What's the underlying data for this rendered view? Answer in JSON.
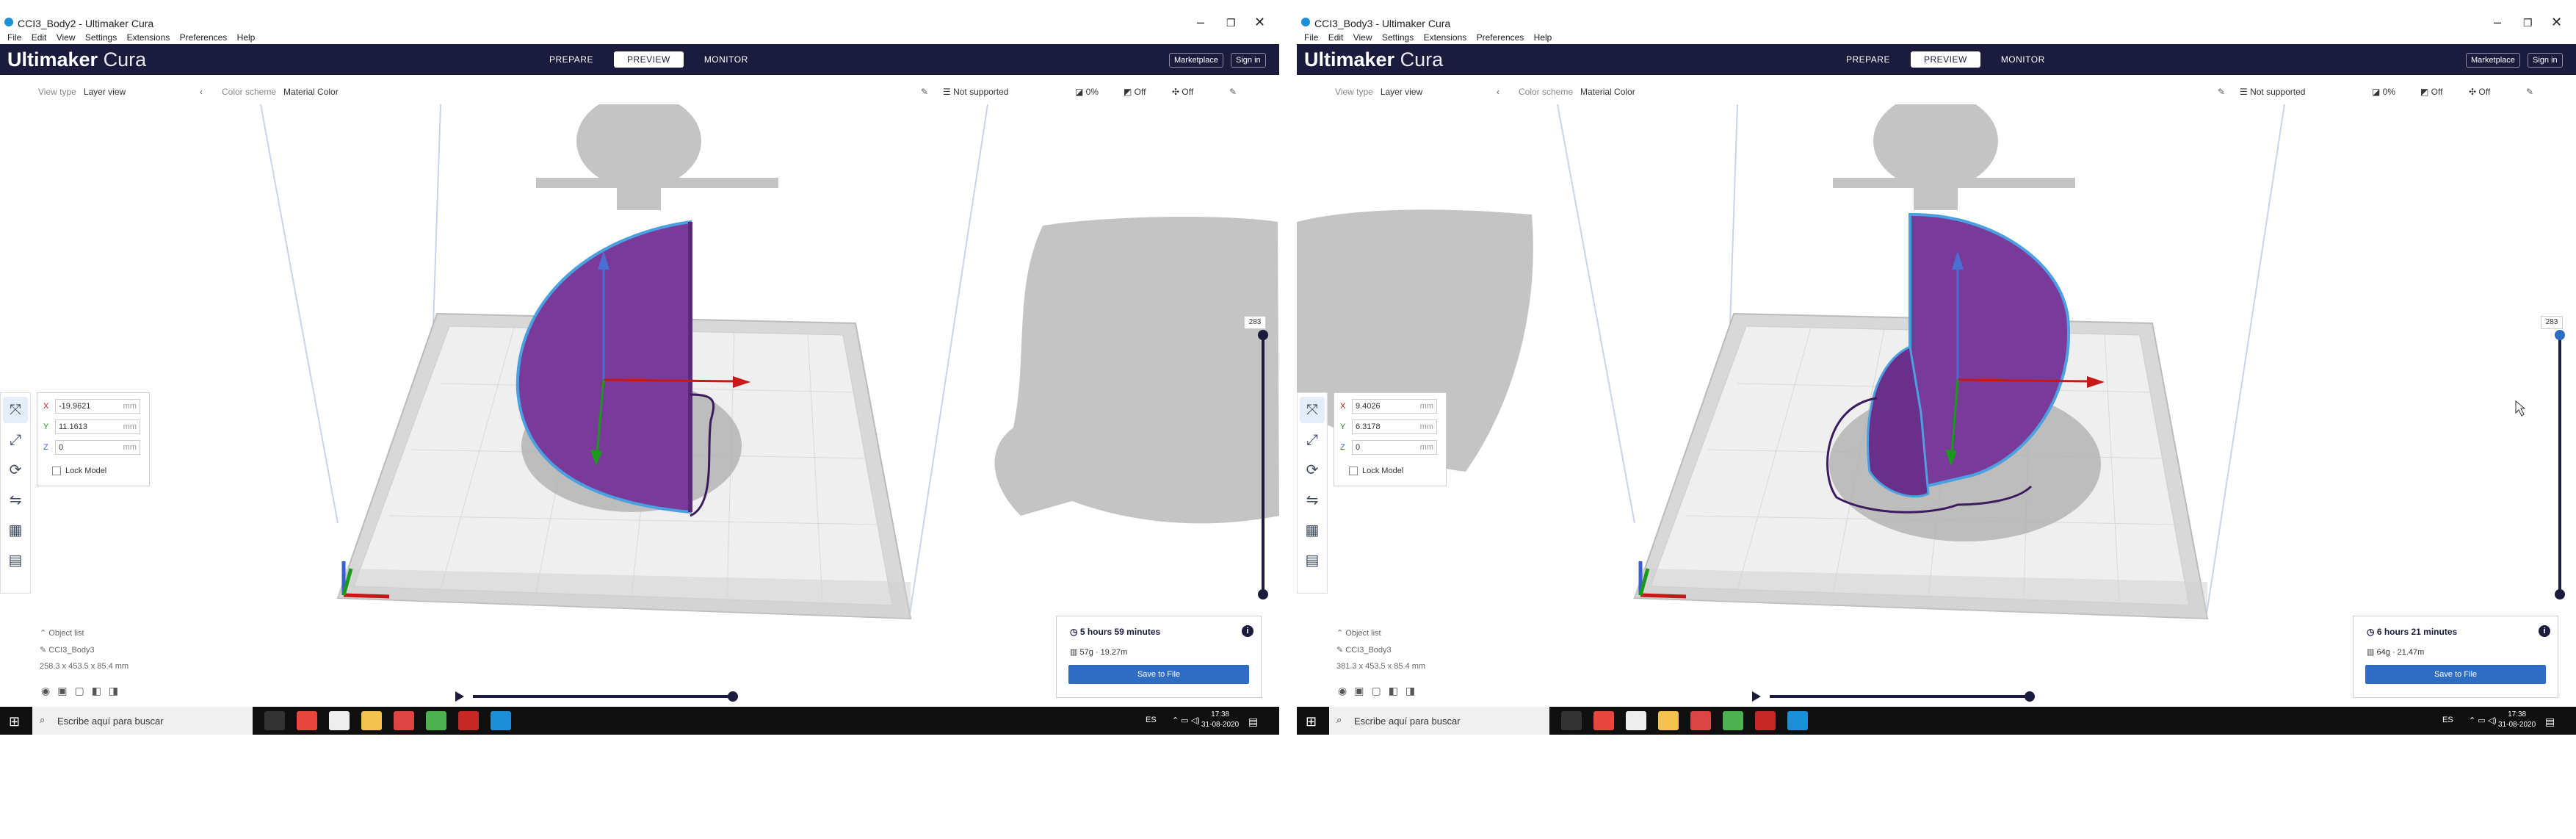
{
  "screens": [
    {
      "window_title": "CCI3_Body2 - Ultimaker Cura",
      "menu": [
        "File",
        "Edit",
        "View",
        "Settings",
        "Extensions",
        "Preferences",
        "Help"
      ],
      "logo": {
        "brand": "Ultimaker",
        "product": "Cura"
      },
      "stages": [
        "PREPARE",
        "PREVIEW",
        "MONITOR"
      ],
      "active_stage": "PREVIEW",
      "marketplace_label": "Marketplace",
      "signin_label": "Sign in",
      "view_type_label": "View type",
      "view_type_value": "Layer view",
      "color_scheme_label": "Color scheme",
      "color_scheme_value": "Material Color",
      "support_value": "Not supported",
      "infill_value": "0%",
      "support_toggle": "Off",
      "adhesion_toggle": "Off",
      "move": {
        "x": "-19.9621",
        "y": "11.1613",
        "z": "0",
        "unit": "mm",
        "lock_label": "Lock Model"
      },
      "layer_number": "283",
      "object_list_label": "Object list",
      "object_name": "CCI3_Body3",
      "object_dims": "258.3 x 453.5 x 85.4 mm",
      "print_time": "5 hours 59 minutes",
      "material": "57g · 19.27m",
      "save_label": "Save to File",
      "search_placeholder": "Escribe aquí para buscar",
      "language": "ES",
      "clock_time": "17:38",
      "clock_date": "31-08-2020"
    },
    {
      "window_title": "CCI3_Body3 - Ultimaker Cura",
      "menu": [
        "File",
        "Edit",
        "View",
        "Settings",
        "Extensions",
        "Preferences",
        "Help"
      ],
      "logo": {
        "brand": "Ultimaker",
        "product": "Cura"
      },
      "stages": [
        "PREPARE",
        "PREVIEW",
        "MONITOR"
      ],
      "active_stage": "PREVIEW",
      "marketplace_label": "Marketplace",
      "signin_label": "Sign in",
      "view_type_label": "View type",
      "view_type_value": "Layer view",
      "color_scheme_label": "Color scheme",
      "color_scheme_value": "Material Color",
      "support_value": "Not supported",
      "infill_value": "0%",
      "support_toggle": "Off",
      "adhesion_toggle": "Off",
      "move": {
        "x": "9.4026",
        "y": "6.3178",
        "z": "0",
        "unit": "mm",
        "lock_label": "Lock Model"
      },
      "layer_number": "283",
      "object_list_label": "Object list",
      "object_name": "CCI3_Body3",
      "object_dims": "381.3 x 453.5 x 85.4 mm",
      "print_time": "6 hours 21 minutes",
      "material": "64g · 21.47m",
      "save_label": "Save to File",
      "search_placeholder": "Escribe aquí para buscar",
      "language": "ES",
      "clock_time": "17:38",
      "clock_date": "31-08-2020"
    }
  ],
  "colors": {
    "header": "#1b1c3d",
    "accent": "#2f6dc4",
    "model_purple": "#7a3a9a",
    "outline_blue": "#4aa0e0"
  }
}
